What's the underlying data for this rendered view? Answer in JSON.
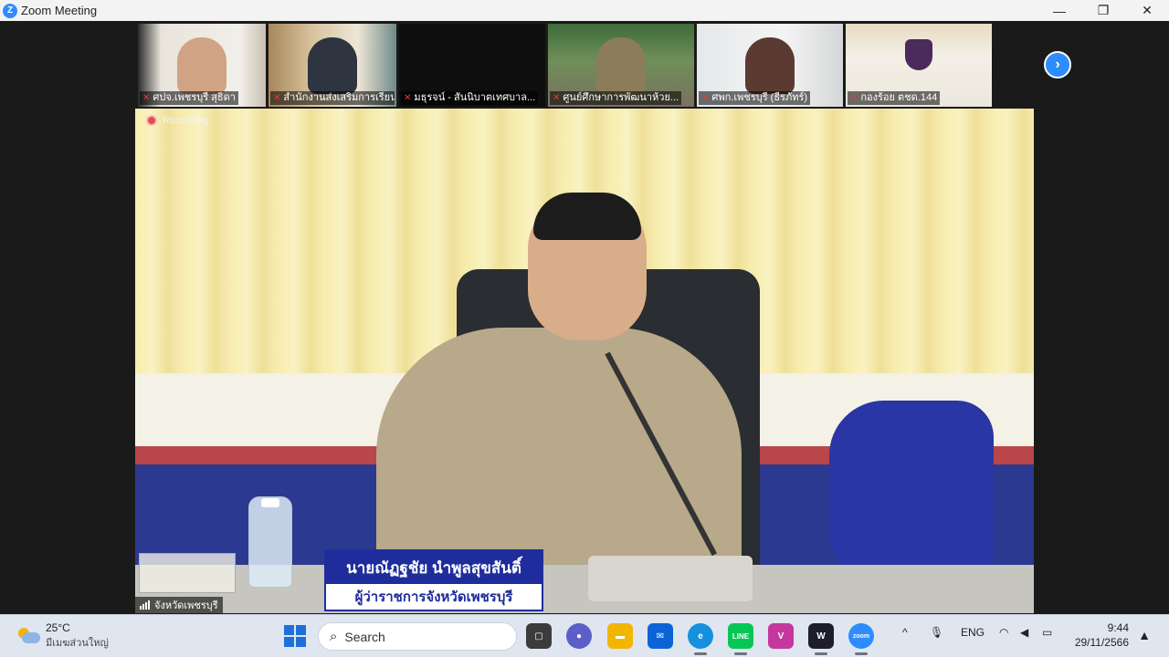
{
  "window": {
    "logo_glyph": "Z",
    "title": "Zoom Meeting",
    "controls": [
      "—",
      "❐",
      "✕"
    ]
  },
  "gallery": [
    {
      "name": "ศปจ.เพชรบุรี สุธิดา",
      "muted": true
    },
    {
      "name": "สำนักงานส่งเสริมการเรียนรู้...",
      "muted": true
    },
    {
      "name": "มธุรจน์ - สันนิบาตเทศบาล...",
      "muted": true
    },
    {
      "name": "ศูนย์ศึกษาการพัฒนาห้วย...",
      "muted": true
    },
    {
      "name": "ศพก.เพชรบุรี (ธีรภัทร์)",
      "muted": true
    },
    {
      "name": "กองร้อย ตชด.144",
      "muted": true
    }
  ],
  "next_page_glyph": "›",
  "main": {
    "recording_label": "Recording",
    "nameplate_name": "นายณัฏฐชัย  นำพูลสุขสันติ์",
    "nameplate_title": "ผู้ว่าราชการจังหวัดเพชรบุรี",
    "speaker_name": "จังหวัดเพชรบุรี"
  },
  "taskbar": {
    "weather_temp": "25°C",
    "weather_desc": "มีเมฆส่วนใหญ่",
    "search_placeholder": "Search",
    "apps": [
      {
        "name": "task-view",
        "color": "#3b3b3b",
        "label": "▢"
      },
      {
        "name": "chat",
        "color": "#5b5fc7",
        "label": "●"
      },
      {
        "name": "file-explorer",
        "color": "#f2b600",
        "label": "▬"
      },
      {
        "name": "mail",
        "color": "#0a64d6",
        "label": "✉"
      },
      {
        "name": "edge",
        "color": "#1490df",
        "label": "e"
      },
      {
        "name": "line",
        "color": "#06c755",
        "label": "LINE"
      },
      {
        "name": "vivaldi",
        "color": "#c5379d",
        "label": "V"
      },
      {
        "name": "clipchamp",
        "color": "#1d1d2e",
        "label": "W"
      },
      {
        "name": "zoom",
        "color": "#2d8cff",
        "label": "zoom"
      }
    ],
    "tray_chevron": "^",
    "language": "ENG",
    "time": "9:44",
    "date": "29/11/2566"
  }
}
